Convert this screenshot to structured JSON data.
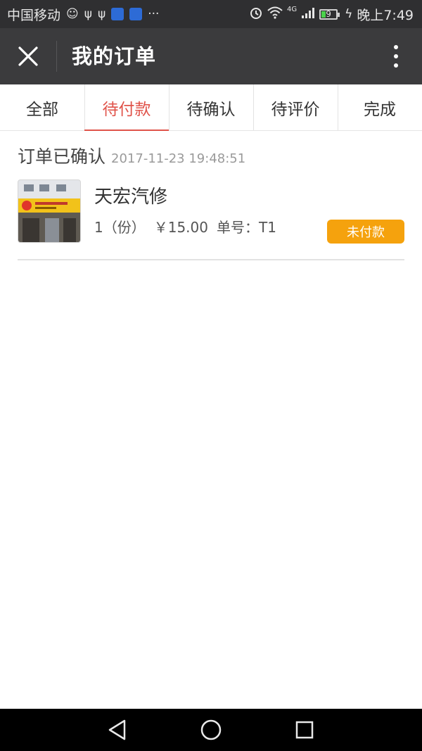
{
  "status_bar": {
    "carrier": "中国移动",
    "network": "4G",
    "battery": "9",
    "time": "晚上7:49",
    "icons": [
      "mood-icon",
      "usb-icon",
      "usb-icon",
      "app-notification-icon",
      "app-notification-icon",
      "more-dots-icon",
      "alarm-icon",
      "wifi-icon",
      "signal-icon",
      "battery-icon",
      "charging-icon"
    ]
  },
  "header": {
    "title": "我的订单",
    "close_icon": "close-icon",
    "menu_icon": "more-vertical-icon"
  },
  "tabs": [
    {
      "label": "全部",
      "active": false
    },
    {
      "label": "待付款",
      "active": true
    },
    {
      "label": "待确认",
      "active": false
    },
    {
      "label": "待评价",
      "active": false
    },
    {
      "label": "完成",
      "active": false
    }
  ],
  "order": {
    "status": "订单已确认",
    "time": "2017-11-23 19:48:51",
    "shop_name": "天宏汽修",
    "quantity": "1（份）",
    "price": "￥15.00",
    "order_no": "单号：T1",
    "pay_status": "未付款"
  },
  "nav_bar": {
    "icons": [
      "back-icon",
      "home-icon",
      "recents-icon"
    ]
  },
  "colors": {
    "accent": "#e0534a",
    "pay_button": "#f5a20d",
    "title_bar": "#3b3b3d",
    "status_bar": "#2f2f31"
  }
}
